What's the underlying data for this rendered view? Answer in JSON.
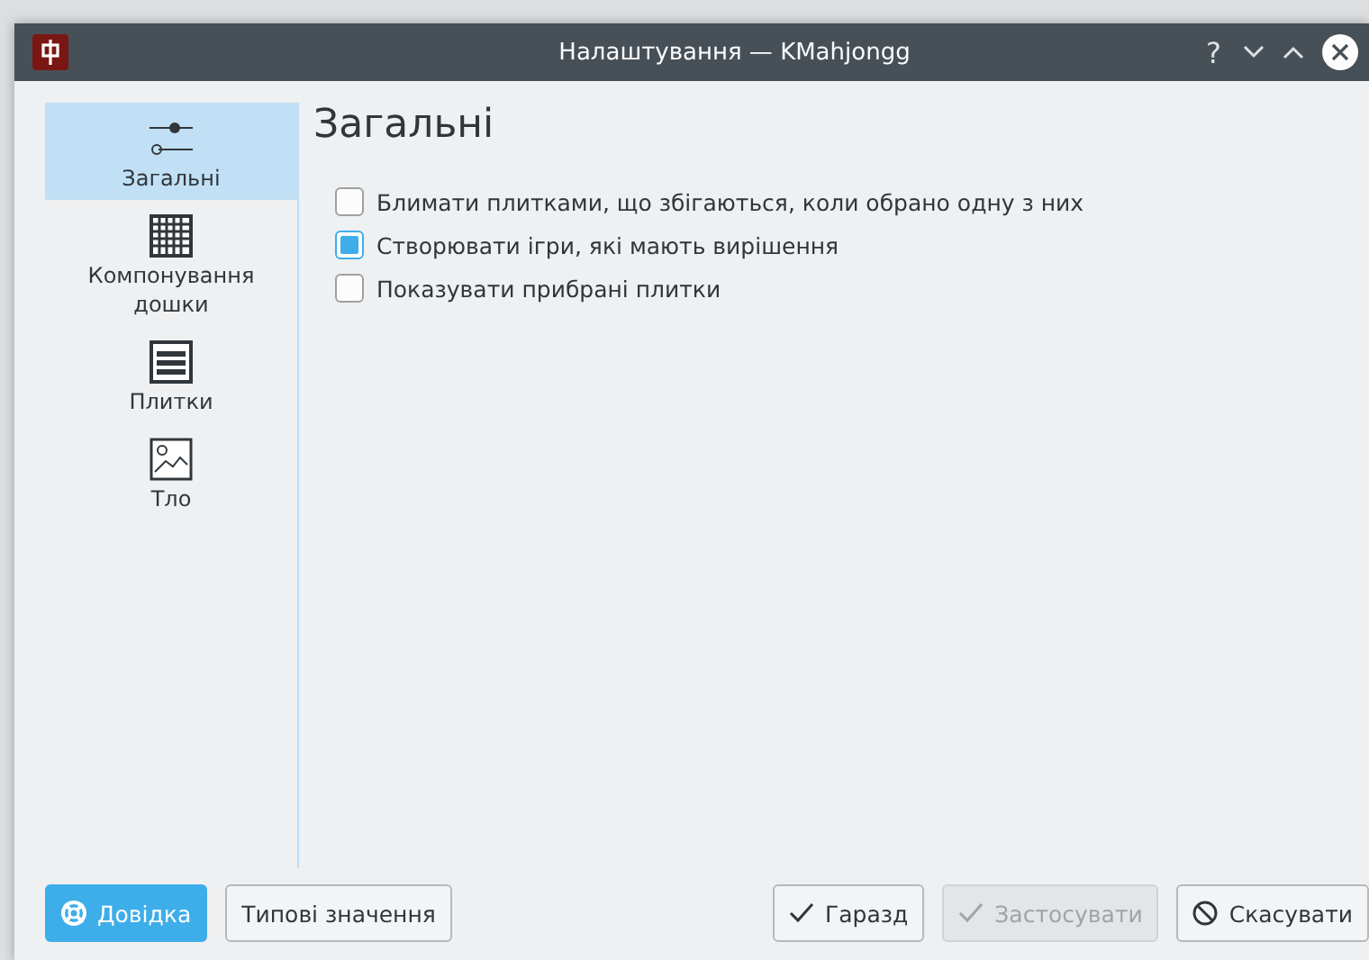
{
  "window": {
    "title": "Налаштування — KMahjongg",
    "title_buttons": [
      "?"
    ]
  },
  "sidebar": {
    "items": [
      {
        "label": "Загальні",
        "kind": "sliders",
        "selected": true
      },
      {
        "label": "Компонування дошки",
        "kind": "grid",
        "selected": false
      },
      {
        "label": "Плитки",
        "kind": "lines",
        "selected": false
      },
      {
        "label": "Тло",
        "kind": "image",
        "selected": false
      }
    ]
  },
  "page": {
    "title": "Загальні",
    "options": [
      {
        "label": "Блимати плитками, що збігаються, коли обрано одну з них",
        "checked": false
      },
      {
        "label": "Створювати ігри, які мають вирішення",
        "checked": true
      },
      {
        "label": "Показувати прибрані плитки",
        "checked": false
      }
    ]
  },
  "buttons_left": [
    {
      "label": "Довідка",
      "kind": "help",
      "default": true,
      "disabled": false
    },
    {
      "label": "Типові значення",
      "kind": "plain",
      "default": false,
      "disabled": false
    }
  ],
  "buttons_right": [
    {
      "label": "Гаразд",
      "kind": "check",
      "default": false,
      "disabled": false
    },
    {
      "label": "Застосувати",
      "kind": "check",
      "default": false,
      "disabled": true
    },
    {
      "label": "Скасувати",
      "kind": "cancel",
      "default": false,
      "disabled": false
    }
  ]
}
